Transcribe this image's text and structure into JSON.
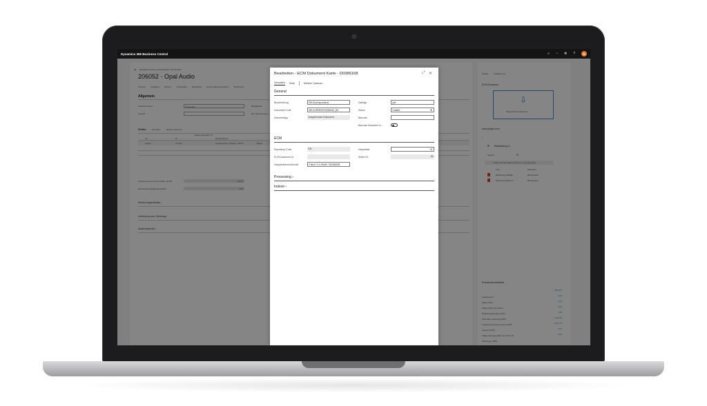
{
  "app": {
    "name": "Dynamics 365 Business Central",
    "user_initial": "D"
  },
  "topbar_icons": [
    "search-icon",
    "bell-icon",
    "gear-icon",
    "help-icon"
  ],
  "background_page": {
    "breadcrumb": "Einkaufsrechnung | Arbeitsdatum: 25.01.2024",
    "title": "206052 · Opal Audio",
    "saved_label": "✓ Gespeichert",
    "action_tabs": [
      "Prozess",
      "Freigeben",
      "Buchen",
      "Vorbereiten",
      "Bestellung",
      "Genehmigung anfordern",
      "Strukturiert"
    ],
    "general": {
      "heading": "Allgemein",
      "fields": [
        {
          "label": "Kreditorenname",
          "value": "Opal Audio"
        },
        {
          "label": "Kontakt",
          "value": ""
        }
      ],
      "mid_labels": [
        "Belegdatum",
        "Ext. Rechnungsnr."
      ]
    },
    "lines": {
      "tabs": [
        "Zeilen",
        "Verwalten",
        "Weitere Optionen"
      ],
      "columns": [
        "Art",
        "Nr.",
        "Referenzbeschr. Nr.",
        "Beschreibung"
      ],
      "row": {
        "type": "Artikel",
        "no": "LS-120",
        "desc": "Lautsprecher, schwarz, 120 W",
        "code": "BLAU"
      }
    },
    "totals": [
      {
        "label": "Zwischensumme Ohne MwSt. (EUR)",
        "value": "136,00"
      },
      {
        "label": "Rechnungsrabattbetrag (EUR)",
        "value": "0,00"
      }
    ],
    "sections": [
      "Rechnungsdetails ›",
      "Lieferung und Zahlung ›",
      "Außenhandel ›"
    ]
  },
  "side_panel": {
    "tabs": [
      "Details",
      "Anhänge (0)"
    ],
    "dropzone": {
      "title": "ECM-Dropzone",
      "hint": "drag and drop files here"
    },
    "plugin": {
      "title": "edoc plugin ecm",
      "folder": "Bestellung 2...",
      "search_label": "Search",
      "filter_placeholder": "Geben Sie die Daten hierhin um sie angezeigt",
      "columns": [
        "Titel",
        "Kategorie"
      ],
      "items": [
        {
          "title": "Bestellung 206052",
          "category": "BH Bestellu"
        },
        {
          "title": "Rechnung 2025-11...",
          "category": "BH Eingang"
        }
      ]
    },
    "stats": {
      "title": "Kreditorenstatistik",
      "rows": [
        {
          "label": "Kreditorennr.",
          "value": "BB-007"
        },
        {
          "label": "Saldo (MW)",
          "value": "0,00"
        },
        {
          "label": "Saldo (MW) als Debitor",
          "value": "0,00"
        },
        {
          "label": "Bestellungsbeträge (MW)",
          "value": "0,00"
        },
        {
          "label": "Nicht fakt. Lieferung (MW)",
          "value": "4,00"
        },
        {
          "label": "Ausstehende Rechnungen (MW)",
          "value": "1.322,81"
        },
        {
          "label": "Gesamt (MW)",
          "value": "5.497,76"
        },
        {
          "label": "Fällige Beträge (MW) per 25.01.24",
          "value": "0,00"
        },
        {
          "label": "Zahlungen (MW)",
          "value": "0,00"
        }
      ]
    }
  },
  "modal": {
    "title": "Bearbeiten - ECM Dokument Karte - D0386168",
    "tabs": [
      "Verwalten",
      "Seite",
      "Weitere Optionen"
    ],
    "general": {
      "heading": "General",
      "left": [
        {
          "label": "Beschreibung",
          "value": "BE-Korrespondenz"
        },
        {
          "label": "Dokument Code",
          "value": "BE-KORRESPONDENZ_DE"
        },
        {
          "label": "Dokumenttyp",
          "value": "Ausgehendes Dokument"
        }
      ],
      "right": [
        {
          "label": "Dateityp",
          "value": "pdf"
        },
        {
          "label": "Status",
          "value": "Erstellt"
        },
        {
          "label": "Barcode",
          "value": ""
        },
        {
          "label": "Barcode Dokument m...",
          "value": ""
        }
      ]
    },
    "ecm": {
      "heading": "ECM",
      "left": [
        {
          "label": "Repository Code",
          "value": "EN"
        },
        {
          "label": "ECM Dokument Id",
          "value": ""
        },
        {
          "label": "Hauptdokument/Anzahl",
          "value": "Folio1+0.1.25469 +D0386253"
        }
      ],
      "right": [
        {
          "label": "Hauptdatei",
          "value": "01"
        },
        {
          "label": "Seiten ID",
          "value": "00"
        }
      ]
    },
    "collapsed": [
      "Processing ›",
      "Indexe ›"
    ]
  },
  "colors": {
    "accent": "#4a88c8",
    "topbar": "#141414",
    "avatar": "#e07a2f"
  }
}
